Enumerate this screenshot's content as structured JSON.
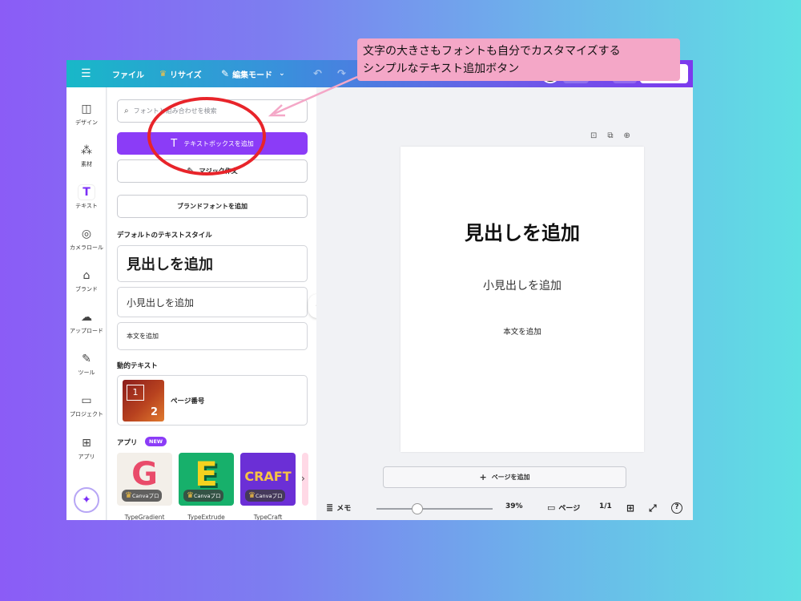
{
  "topbar": {
    "menu_icon": "hamburger-icon",
    "file_label": "ファイル",
    "resize_label": "リサイズ",
    "edit_mode_label": "編集モード"
  },
  "rail": {
    "items": [
      {
        "label": "デザイン",
        "icon": "design-icon"
      },
      {
        "label": "素材",
        "icon": "elements-icon"
      },
      {
        "label": "テキスト",
        "icon": "text-icon"
      },
      {
        "label": "カメラロール",
        "icon": "camera-icon"
      },
      {
        "label": "ブランド",
        "icon": "brand-icon"
      },
      {
        "label": "アップロード",
        "icon": "upload-icon"
      },
      {
        "label": "ツール",
        "icon": "tools-icon"
      },
      {
        "label": "プロジェクト",
        "icon": "folder-icon"
      },
      {
        "label": "アプリ",
        "icon": "apps-icon"
      }
    ]
  },
  "panel": {
    "search_placeholder": "フォントと組み合わせを検索",
    "add_textbox_label": "テキストボックスを追加",
    "magic_write_label": "マジック作文",
    "add_brand_font_label": "ブランドフォントを追加",
    "default_styles_title": "デフォルトのテキストスタイル",
    "heading_label": "見出しを追加",
    "subheading_label": "小見出しを追加",
    "body_label": "本文を追加",
    "dynamic_text_title": "動的テキスト",
    "page_number_label": "ページ番号",
    "page_number_thumb_1": "1",
    "page_number_thumb_2": "2",
    "apps_title": "アプリ",
    "new_badge": "NEW",
    "apps": [
      {
        "name": "TypeGradient",
        "logo": "G",
        "pro": "Canvaプロ"
      },
      {
        "name": "TypeExtrude",
        "logo": "E",
        "pro": "Canvaプロ"
      },
      {
        "name": "TypeCraft",
        "logo": "CRAFT",
        "pro": "Canvaプロ"
      }
    ]
  },
  "canvas": {
    "heading": "見出しを追加",
    "subheading": "小見出しを追加",
    "body": "本文を追加",
    "add_page_label": "ページを追加"
  },
  "bottombar": {
    "memo_label": "メモ",
    "zoom": "39%",
    "zoom_fraction": 0.39,
    "page_label": "ページ",
    "page_count": "1/1"
  },
  "annotation": {
    "line1": "文字の大きさもフォントも自分でカスタマイズする",
    "line2": "シンプルなテキスト追加ボタン"
  },
  "colors": {
    "accent": "#8b3cf7",
    "highlight": "#e8242a",
    "callout_bg": "#f4a7c7"
  }
}
